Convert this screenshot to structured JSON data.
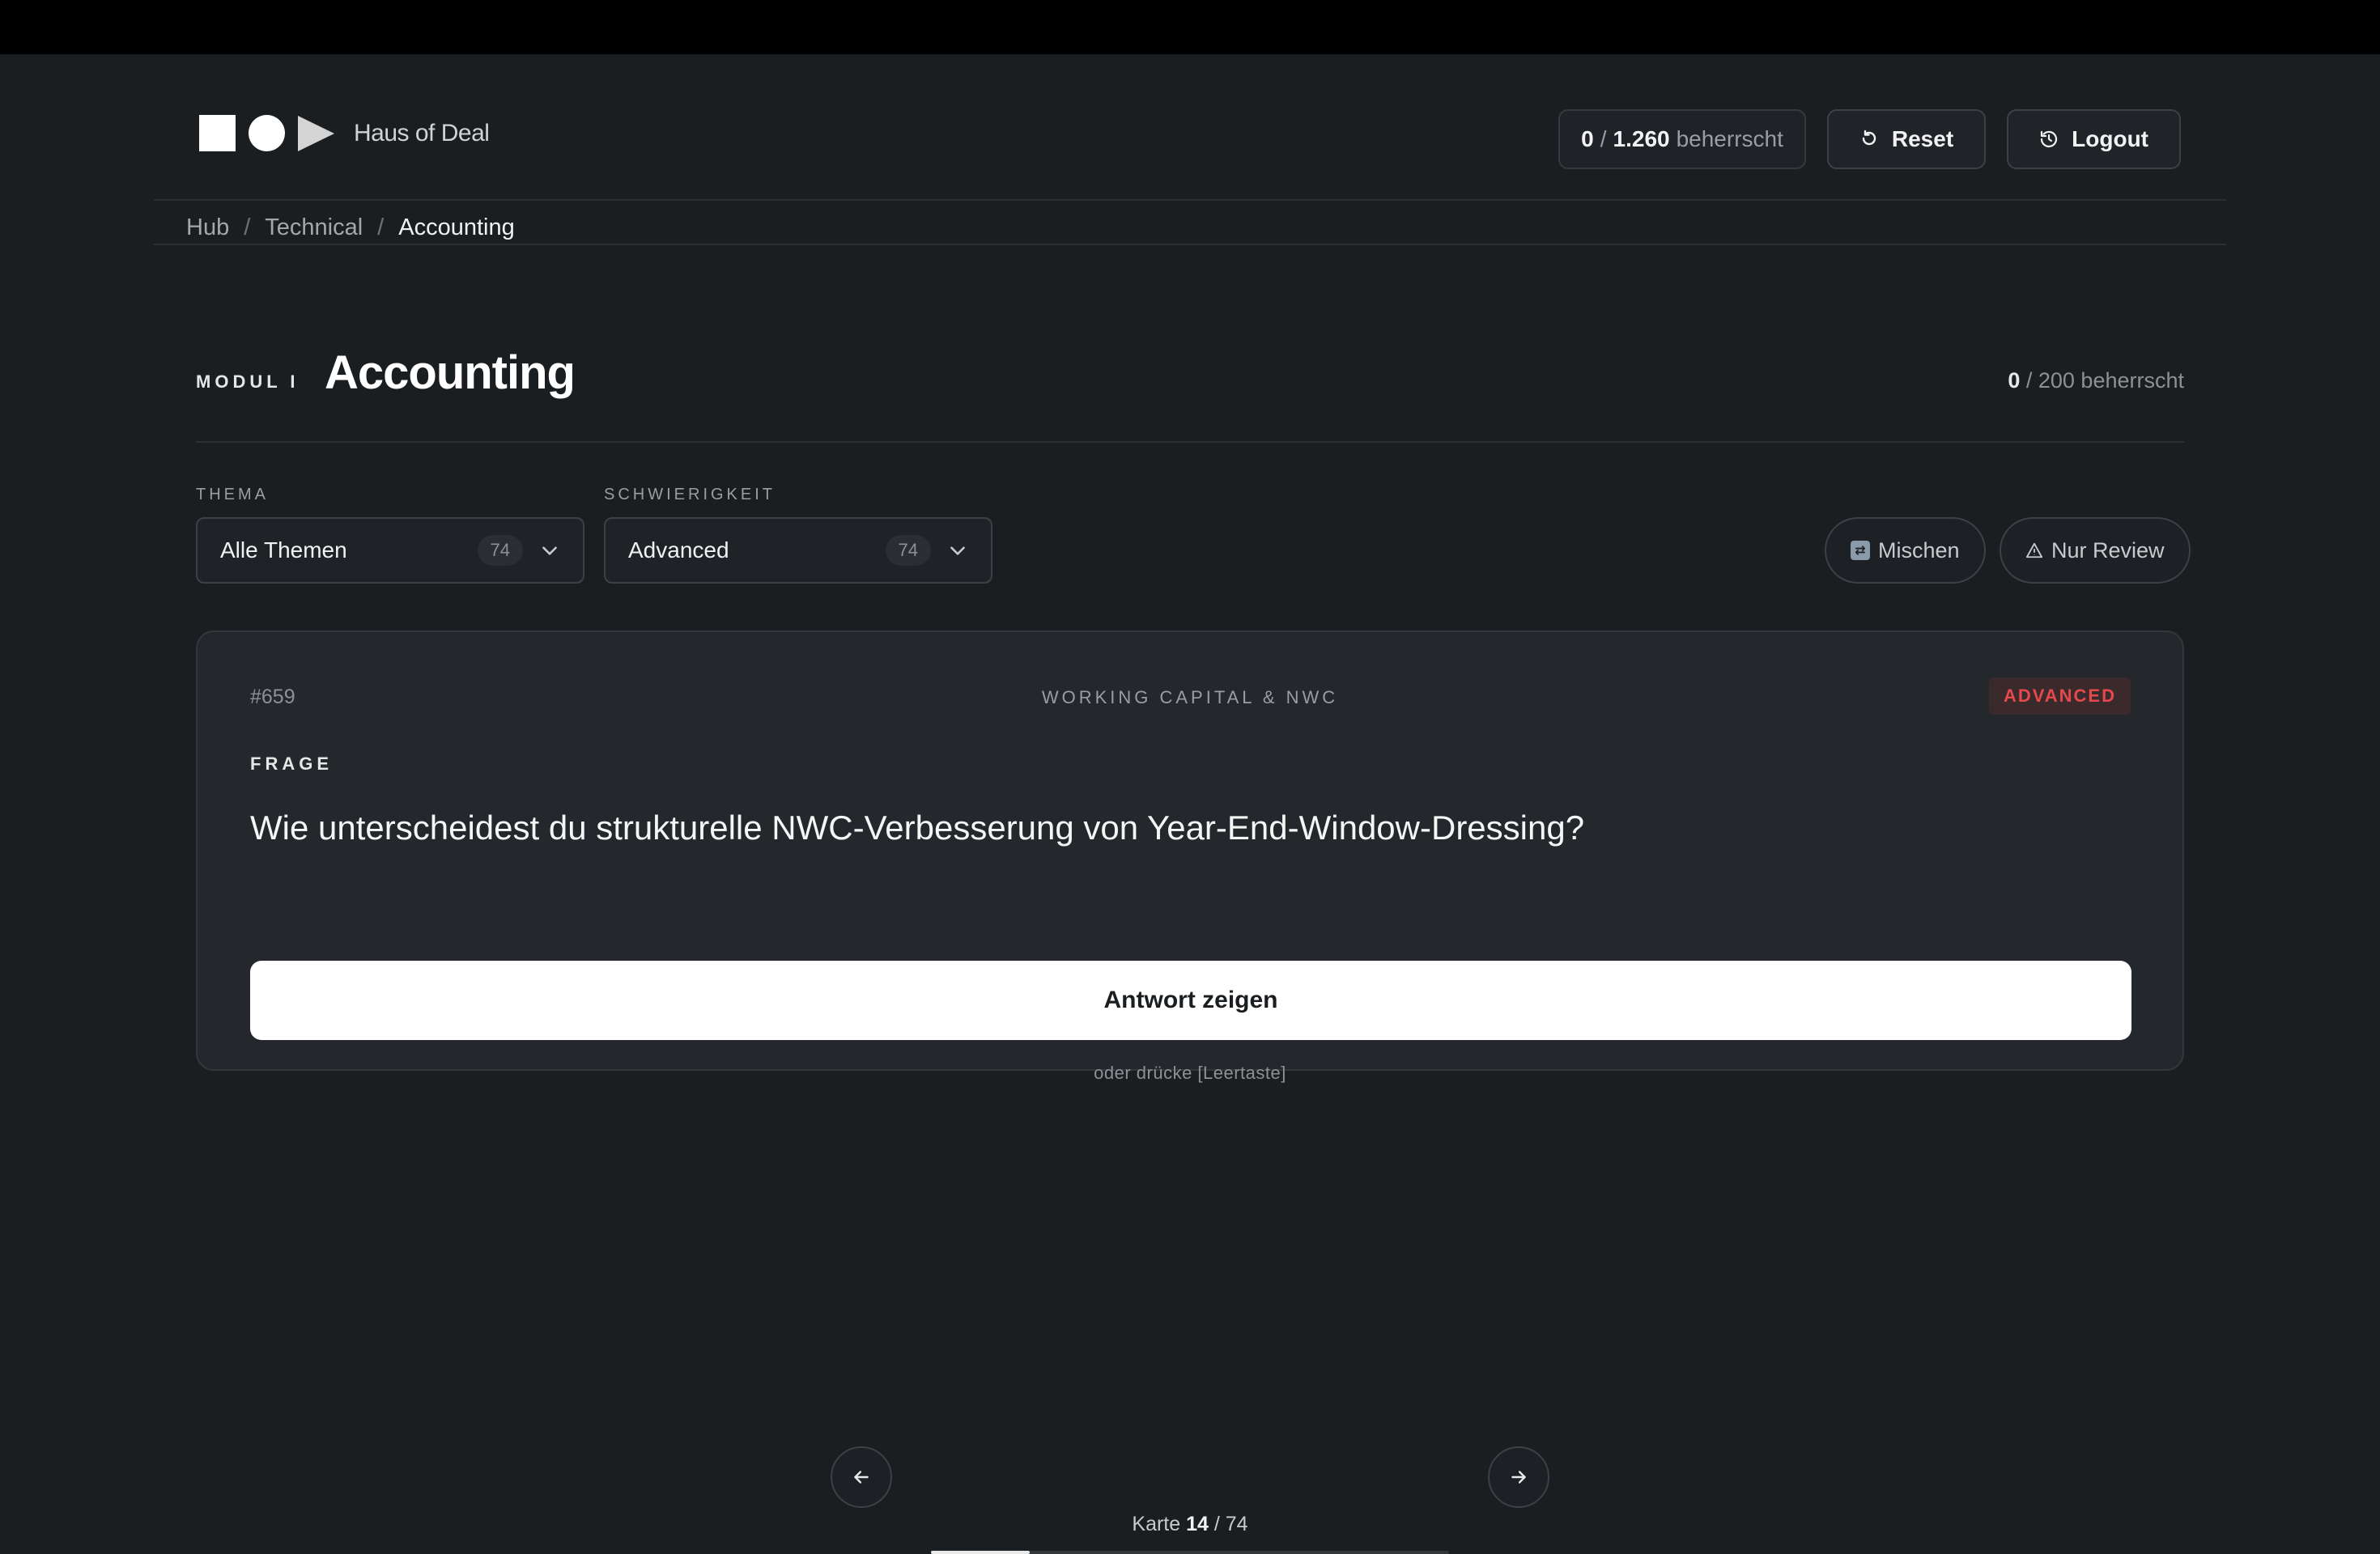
{
  "header": {
    "brand": "Haus of Deal",
    "mastery_count": "0",
    "mastery_total": "1.260",
    "mastery_label": "beherrscht",
    "reset_label": "Reset",
    "logout_label": "Logout"
  },
  "breadcrumb": {
    "items": [
      "Hub",
      "Technical",
      "Accounting"
    ],
    "separator": "/"
  },
  "module": {
    "kicker": "MODUL I",
    "title": "Accounting",
    "mastered": "0",
    "total_text": "/ 200 beherrscht"
  },
  "filters": {
    "topic_label": "THEMA",
    "topic_value": "Alle Themen",
    "topic_count": "74",
    "difficulty_label": "SCHWIERIGKEIT",
    "difficulty_value": "Advanced",
    "difficulty_count": "74",
    "shuffle_label": "Mischen",
    "review_label": "Nur Review"
  },
  "card": {
    "id": "#659",
    "topic": "WORKING CAPITAL & NWC",
    "difficulty_badge": "ADVANCED",
    "question_label": "FRAGE",
    "question": "Wie unterscheidest du strukturelle NWC-Verbesserung von Year-End-Window-Dressing?",
    "answer_button": "Antwort zeigen",
    "hint": "oder drücke [Leertaste]"
  },
  "pager": {
    "prefix": "Karte",
    "current": "14",
    "total_text": "/ 74",
    "progress": 0.19
  },
  "colors": {
    "background": "#1b1e21",
    "card": "#24272b",
    "accent_danger": "#e5484d",
    "primary_button": "#ffffff"
  }
}
